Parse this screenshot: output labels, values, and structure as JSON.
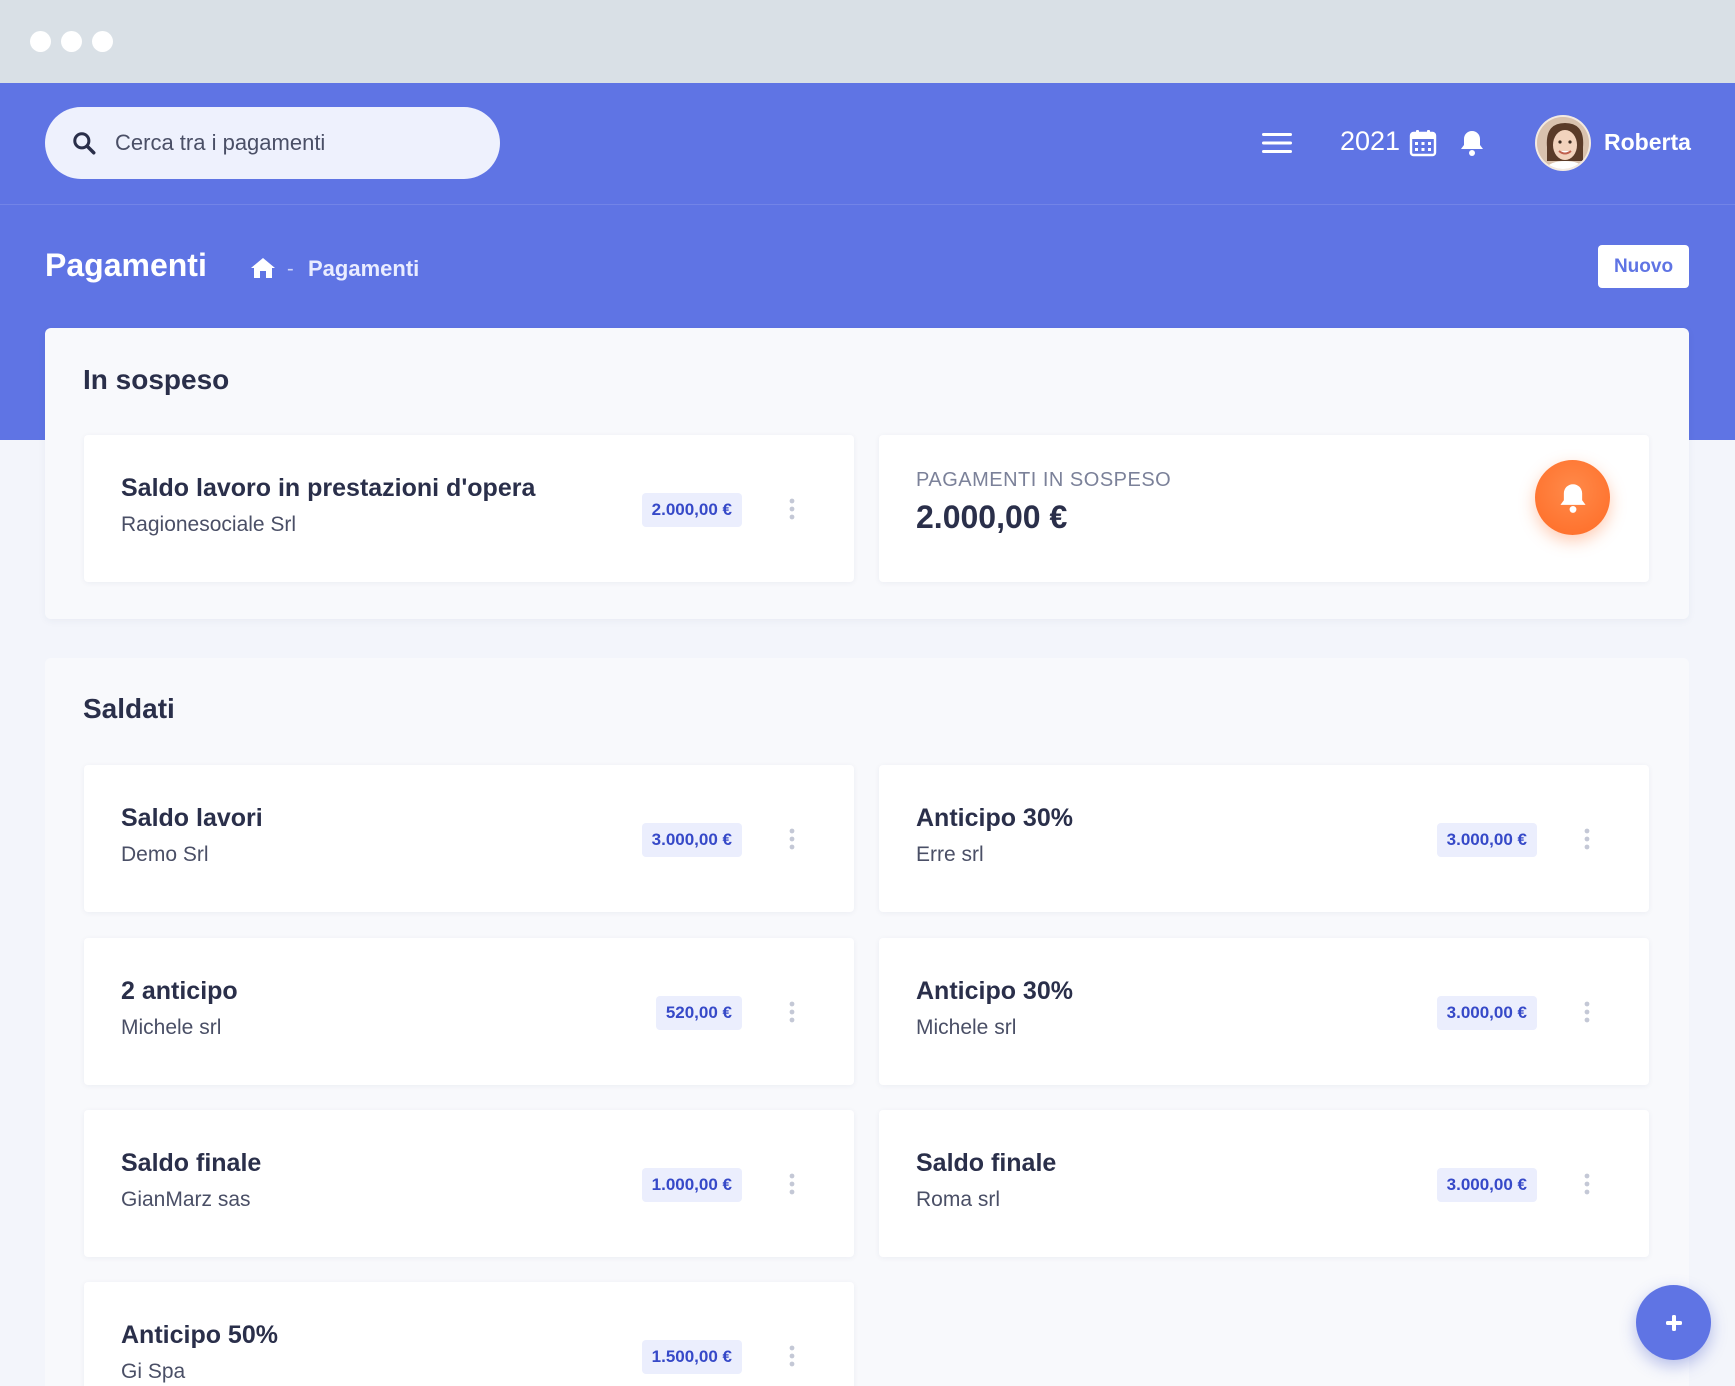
{
  "header": {
    "search": {
      "placeholder": "Cerca tra i pagamenti"
    },
    "year": "2021",
    "user": {
      "name": "Roberta"
    }
  },
  "page": {
    "title": "Pagamenti",
    "breadcrumb": {
      "separator": "-",
      "current": "Pagamenti"
    },
    "new_button": "Nuovo"
  },
  "pending": {
    "title": "In sospeso",
    "items": [
      {
        "title": "Saldo lavoro in prestazioni d'opera",
        "client": "Ragionesociale Srl",
        "amount": "2.000,00 €"
      }
    ],
    "summary": {
      "label": "PAGAMENTI IN SOSPESO",
      "amount": "2.000,00 €"
    }
  },
  "settled": {
    "title": "Saldati",
    "items": [
      {
        "title": "Saldo lavori",
        "client": "Demo Srl",
        "amount": "3.000,00 €"
      },
      {
        "title": "Anticipo 30%",
        "client": "Erre srl",
        "amount": "3.000,00 €"
      },
      {
        "title": "2 anticipo",
        "client": "Michele srl",
        "amount": "520,00 €"
      },
      {
        "title": "Anticipo 30%",
        "client": "Michele srl",
        "amount": "3.000,00 €"
      },
      {
        "title": "Saldo finale",
        "client": "GianMarz sas",
        "amount": "1.000,00 €"
      },
      {
        "title": "Saldo finale",
        "client": "Roma srl",
        "amount": "3.000,00 €"
      },
      {
        "title": "Anticipo 50%",
        "client": "Gi Spa",
        "amount": "1.500,00 €"
      }
    ]
  },
  "icons": {
    "search": "search-icon",
    "menu": "menu-icon",
    "calendar": "calendar-icon",
    "notifications": "bell-icon",
    "home": "home-icon",
    "more": "more-vertical-icon",
    "add": "plus-icon"
  },
  "colors": {
    "primary": "#5f74e4",
    "badge_bg": "#ebeefd",
    "badge_text": "#3649c8",
    "alert": "#ff6b25"
  }
}
